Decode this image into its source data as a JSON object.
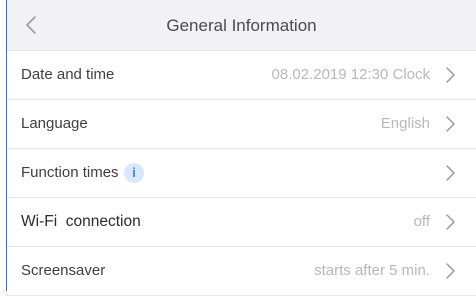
{
  "header": {
    "title": "General Information",
    "back_icon": "chevron-left-icon"
  },
  "rows": [
    {
      "label": "Date and time",
      "value": "08.02.2019 12:30 Clock"
    },
    {
      "label": "Language",
      "value": "English"
    },
    {
      "label": "Function times",
      "value": "",
      "info_icon": "i"
    },
    {
      "label": "Wi-Fi  connection",
      "value": "off"
    },
    {
      "label": "Screensaver",
      "value": "starts after 5 min."
    }
  ],
  "colors": {
    "accent": "#3a86e0",
    "header_bg": "#f2f2f4",
    "value_text": "#b8b8be",
    "left_rule": "#2f6bd8"
  }
}
